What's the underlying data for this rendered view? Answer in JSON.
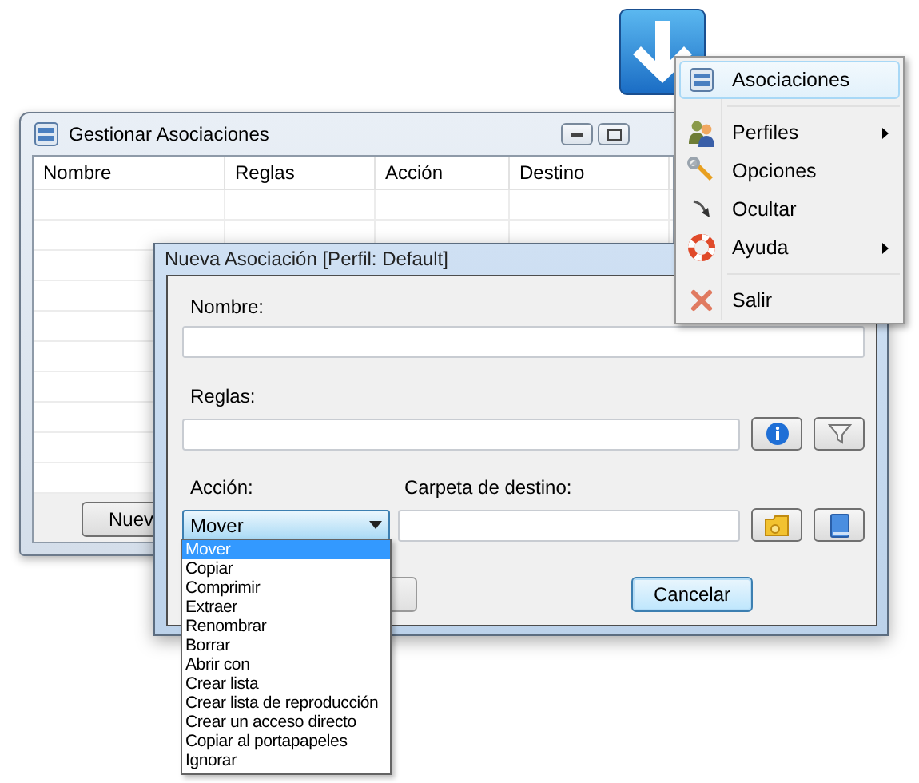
{
  "manager_window": {
    "title": "Gestionar Asociaciones",
    "columns": [
      "Nombre",
      "Reglas",
      "Acción",
      "Destino"
    ],
    "button": "Nuev"
  },
  "context_menu": {
    "items": [
      {
        "kind": "item",
        "label": "Asociaciones",
        "selected": true,
        "submenu": false
      },
      {
        "kind": "separator"
      },
      {
        "kind": "item",
        "label": "Perfiles",
        "selected": false,
        "submenu": true
      },
      {
        "kind": "item",
        "label": "Opciones",
        "selected": false,
        "submenu": false
      },
      {
        "kind": "item",
        "label": "Ocultar",
        "selected": false,
        "submenu": false
      },
      {
        "kind": "item",
        "label": "Ayuda",
        "selected": false,
        "submenu": true
      },
      {
        "kind": "separator"
      },
      {
        "kind": "item",
        "label": "Salir",
        "selected": false,
        "submenu": false
      }
    ]
  },
  "dialog": {
    "title": "Nueva Asociación [Perfil: Default]",
    "name_label": "Nombre:",
    "rules_label": "Reglas:",
    "action_label": "Acción:",
    "destination_label": "Carpeta de destino:",
    "action_value": "Mover",
    "cancel_button": "Cancelar",
    "action_options": [
      {
        "label": "Mover",
        "selected": true
      },
      {
        "label": "Copiar",
        "selected": false
      },
      {
        "label": "Comprimir",
        "selected": false
      },
      {
        "label": "Extraer",
        "selected": false
      },
      {
        "label": "Renombrar",
        "selected": false
      },
      {
        "label": "Borrar",
        "selected": false
      },
      {
        "label": "Abrir con",
        "selected": false
      },
      {
        "label": "Crear lista",
        "selected": false
      },
      {
        "label": "Crear lista de reproducción",
        "selected": false
      },
      {
        "label": "Crear un acceso directo",
        "selected": false
      },
      {
        "label": "Copiar al portapapeles",
        "selected": false
      },
      {
        "label": "Ignorar",
        "selected": false
      }
    ]
  }
}
